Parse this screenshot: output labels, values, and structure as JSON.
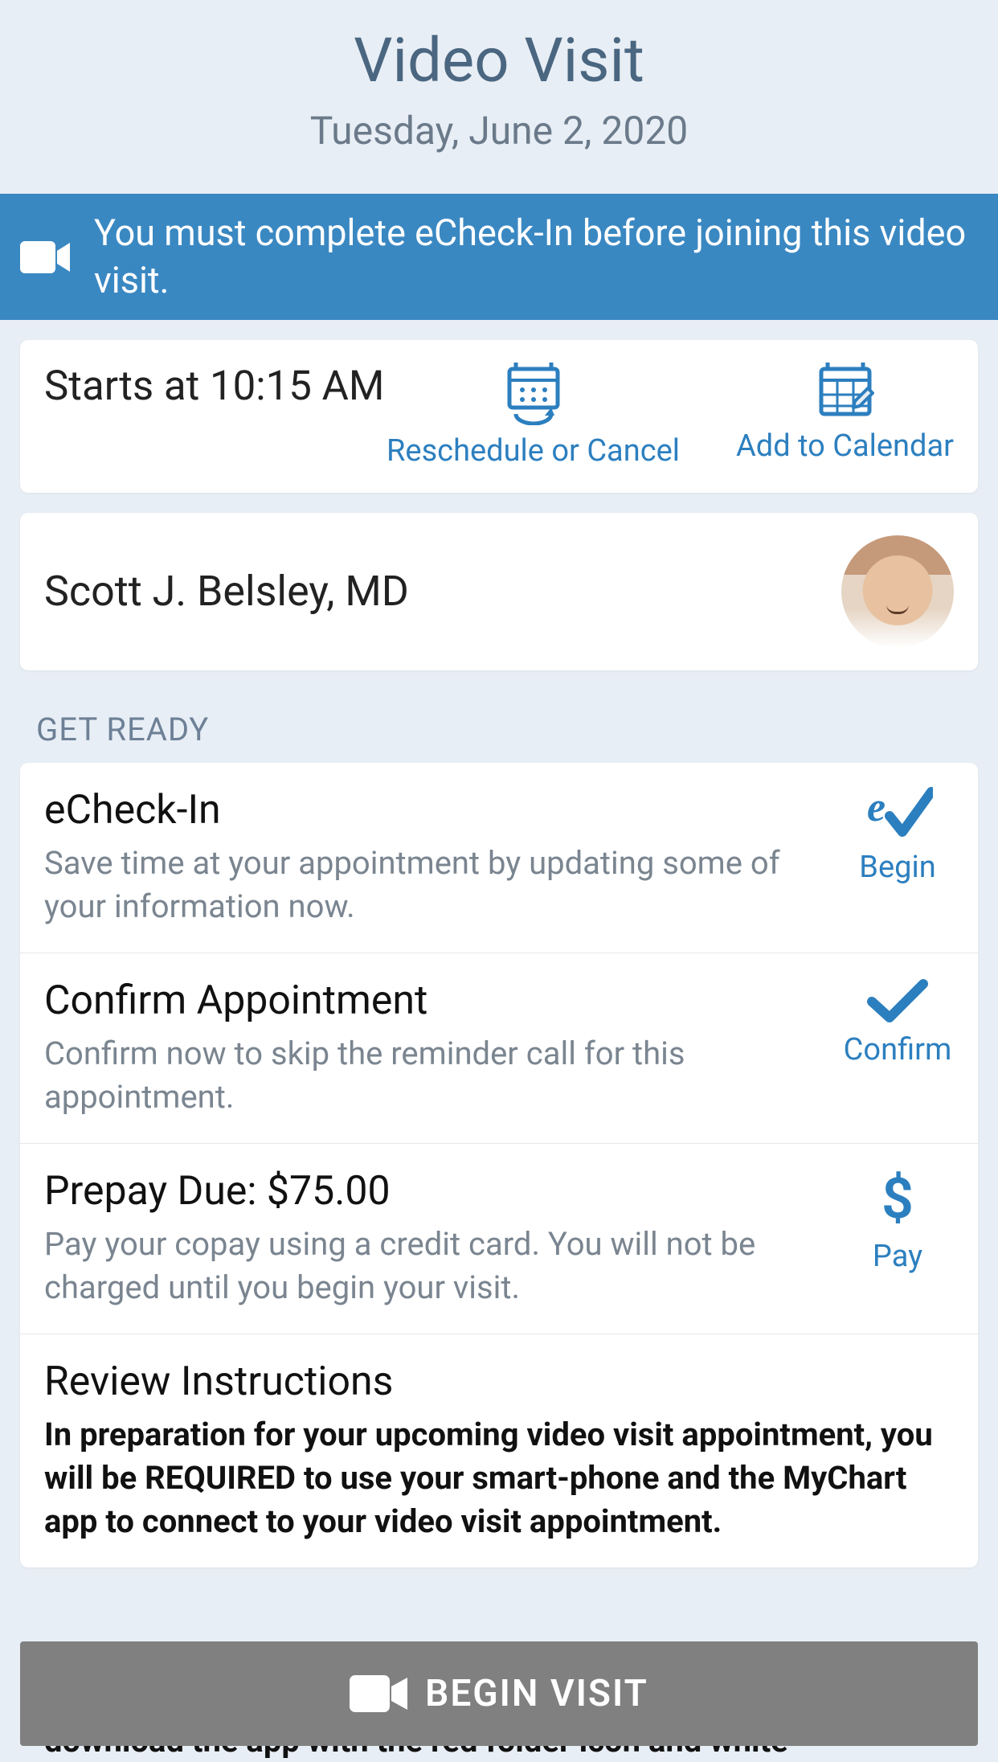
{
  "header": {
    "title": "Video Visit",
    "date": "Tuesday, June 2, 2020"
  },
  "banner": {
    "text": "You must complete eCheck-In before joining this video visit."
  },
  "appointment": {
    "starts_label": "Starts at 10:15 AM",
    "reschedule_label": "Reschedule or Cancel",
    "add_calendar_label": "Add to Calendar"
  },
  "provider": {
    "name": "Scott J. Belsley, MD"
  },
  "get_ready": {
    "title": "GET READY",
    "items": [
      {
        "title": "eCheck-In",
        "desc": "Save time at your appointment by updating some of your information now.",
        "action": "Begin"
      },
      {
        "title": "Confirm Appointment",
        "desc": "Confirm now to skip the reminder call for this appointment.",
        "action": "Confirm"
      },
      {
        "title": "Prepay Due: $75.00",
        "desc": "Pay your copay using a credit card. You will not be charged until you begin your visit.",
        "action": "Pay"
      },
      {
        "title": "Review Instructions",
        "desc": "In preparation for your upcoming video visit appointment, you will be REQUIRED to use your smart-phone and the MyChart app to connect to your video visit appointment.",
        "action": ""
      }
    ]
  },
  "footer_button": {
    "label": "BEGIN VISIT"
  },
  "truncated": "download the app with the red folder icon and white"
}
